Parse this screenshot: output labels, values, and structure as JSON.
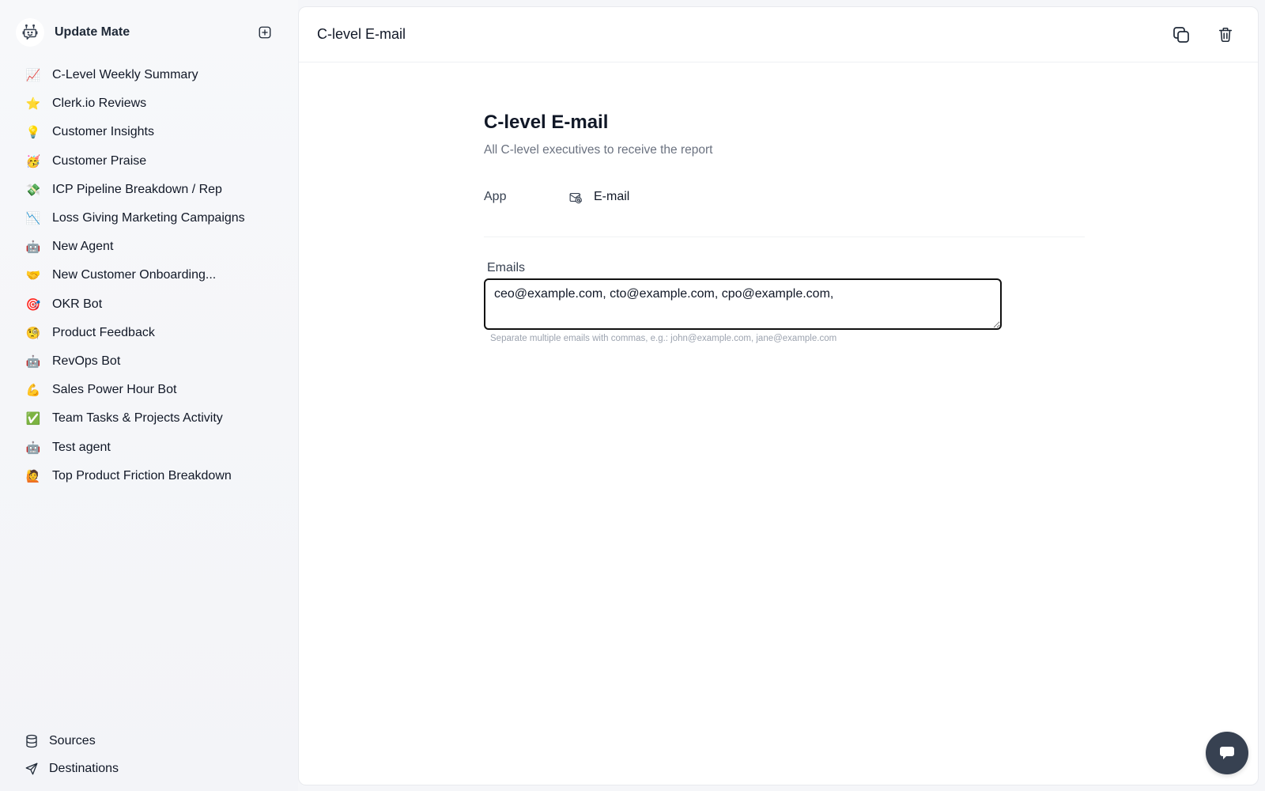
{
  "sidebar": {
    "brand": {
      "name": "Update Mate",
      "logo_icon": "robot-face-icon"
    },
    "add_button_icon": "plus-square-icon",
    "items": [
      {
        "label": "C-Level Weekly Summary",
        "emoji": "📈"
      },
      {
        "label": "Clerk.io Reviews",
        "emoji": "⭐"
      },
      {
        "label": "Customer Insights",
        "emoji": "💡"
      },
      {
        "label": "Customer Praise",
        "emoji": "🥳"
      },
      {
        "label": "ICP Pipeline Breakdown / Rep",
        "emoji": "💸"
      },
      {
        "label": "Loss Giving Marketing Campaigns",
        "emoji": "📉"
      },
      {
        "label": "New Agent",
        "emoji": "🤖"
      },
      {
        "label": "New Customer Onboarding...",
        "emoji": "🤝"
      },
      {
        "label": "OKR Bot",
        "emoji": "🎯"
      },
      {
        "label": "Product Feedback",
        "emoji": "🧐"
      },
      {
        "label": "RevOps Bot",
        "emoji": "🤖"
      },
      {
        "label": "Sales Power Hour Bot",
        "emoji": "💪"
      },
      {
        "label": "Team Tasks & Projects Activity",
        "emoji": "✅"
      },
      {
        "label": "Test agent",
        "emoji": "🤖"
      },
      {
        "label": "Top Product Friction Breakdown",
        "emoji": "🙋"
      }
    ],
    "footer": [
      {
        "label": "Sources",
        "icon": "database-icon"
      },
      {
        "label": "Destinations",
        "icon": "send-icon"
      }
    ]
  },
  "header": {
    "title": "C-level E-mail",
    "actions": [
      {
        "name": "duplicate",
        "icon": "copy-icon"
      },
      {
        "name": "delete",
        "icon": "trash-icon"
      }
    ]
  },
  "destination": {
    "title": "C-level E-mail",
    "description": "All C-level executives to receive the report",
    "app_label": "App",
    "app_value": "E-mail",
    "app_icon": "mail-icon",
    "emails_label": "Emails",
    "emails_value": "ceo@example.com, cto@example.com, cpo@example.com,",
    "emails_help": "Separate multiple emails with commas, e.g.: john@example.com, jane@example.com"
  },
  "chat": {
    "icon": "chat-bubble-icon"
  },
  "colors": {
    "background": "#f5f6f9",
    "card": "#ffffff",
    "text_primary": "#111827",
    "text_muted": "#6b7280",
    "help_text": "#9ca3af",
    "chat_fab": "#374151"
  }
}
